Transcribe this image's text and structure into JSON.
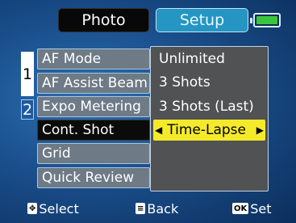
{
  "tabs": [
    {
      "label": "Photo"
    },
    {
      "label": "Setup"
    }
  ],
  "battery": {
    "icon": "battery-full-icon",
    "fill_color": "#39c63c"
  },
  "pages": [
    "1",
    "2"
  ],
  "menu": {
    "items": [
      {
        "label": "AF Mode"
      },
      {
        "label": "AF Assist Beam"
      },
      {
        "label": "Expo Metering"
      },
      {
        "label": "Cont. Shot"
      },
      {
        "label": "Grid"
      },
      {
        "label": "Quick Review"
      }
    ]
  },
  "submenu": {
    "options": [
      {
        "label": "Unlimited"
      },
      {
        "label": "3 Shots"
      },
      {
        "label": "3 Shots (Last)"
      },
      {
        "label": "Time-Lapse"
      }
    ],
    "highlight_color": "#f4ea2a"
  },
  "footer": {
    "select_icon": "dpad-icon",
    "select_label": "Select",
    "back_icon": "menu-key-icon",
    "back_label": "Back",
    "set_icon": "ok-key-icon",
    "set_key_text": "OK",
    "set_label": "Set"
  }
}
